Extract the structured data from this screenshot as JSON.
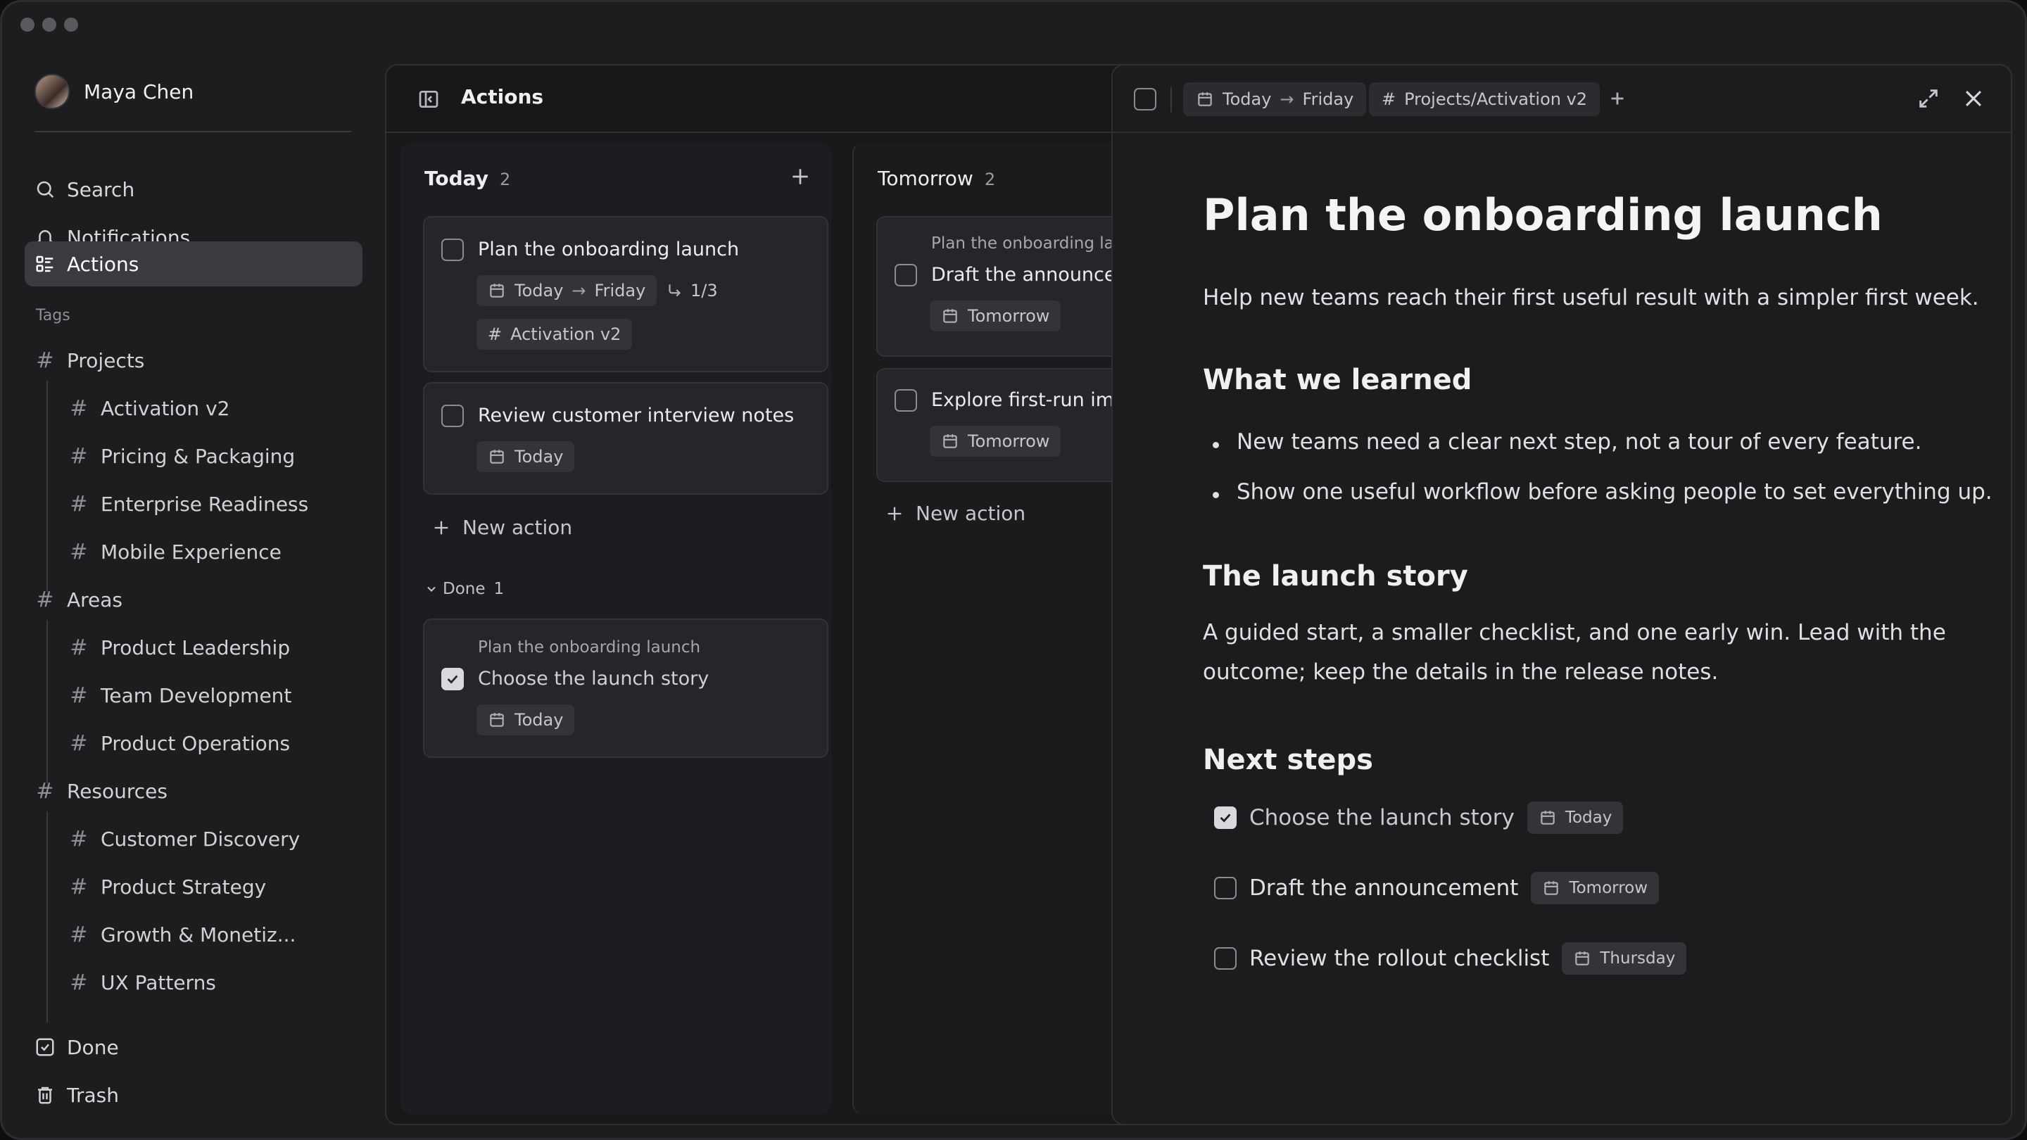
{
  "user": {
    "name": "Maya Chen"
  },
  "nav": {
    "search": "Search",
    "notifications": "Notifications",
    "actions": "Actions",
    "tags_label": "Tags",
    "done": "Done",
    "trash": "Trash"
  },
  "tags": {
    "projects": {
      "label": "Projects",
      "items": [
        "Activation v2",
        "Pricing & Packaging",
        "Enterprise Readiness",
        "Mobile Experience"
      ]
    },
    "areas": {
      "label": "Areas",
      "items": [
        "Product Leadership",
        "Team Development",
        "Product Operations"
      ]
    },
    "resources": {
      "label": "Resources",
      "items": [
        "Customer Discovery",
        "Product Strategy",
        "Growth & Monetiz...",
        "UX Patterns"
      ]
    }
  },
  "main": {
    "title": "Actions",
    "today": {
      "title": "Today",
      "count": "2",
      "cards": [
        {
          "title": "Plan the onboarding launch",
          "date_from": "Today",
          "date_to": "Friday",
          "subtasks": "1/3",
          "tag": "Activation v2"
        },
        {
          "title": "Review customer interview notes",
          "date": "Today"
        }
      ],
      "new_action": "New action",
      "done_label": "Done",
      "done_count": "1",
      "done_card": {
        "parent": "Plan the onboarding launch",
        "title": "Choose the launch story",
        "date": "Today"
      }
    },
    "tomorrow": {
      "title": "Tomorrow",
      "count": "2",
      "cards": [
        {
          "parent": "Plan the onboarding laun",
          "title": "Draft the announceme",
          "date": "Tomorrow"
        },
        {
          "title": "Explore first-run impro",
          "date": "Tomorrow"
        }
      ],
      "new_action": "New action"
    }
  },
  "detail": {
    "date_from": "Today",
    "date_to": "Friday",
    "tag": "Projects/Activation v2",
    "title": "Plan the onboarding launch",
    "intro": "Help new teams reach their first useful result with a simpler first week.",
    "learned_heading": "What we learned",
    "learned": [
      "New teams need a clear next step, not a tour of every feature.",
      "Show one useful workflow before asking people to set everything up."
    ],
    "story_heading": "The launch story",
    "story": "A guided start, a smaller checklist, and one early win. Lead with the outcome; keep the details in the release notes.",
    "next_heading": "Next steps",
    "steps": [
      {
        "title": "Choose the launch story",
        "date": "Today",
        "done": true
      },
      {
        "title": "Draft the announcement",
        "date": "Tomorrow",
        "done": false
      },
      {
        "title": "Review the rollout checklist",
        "date": "Thursday",
        "done": false
      }
    ]
  }
}
